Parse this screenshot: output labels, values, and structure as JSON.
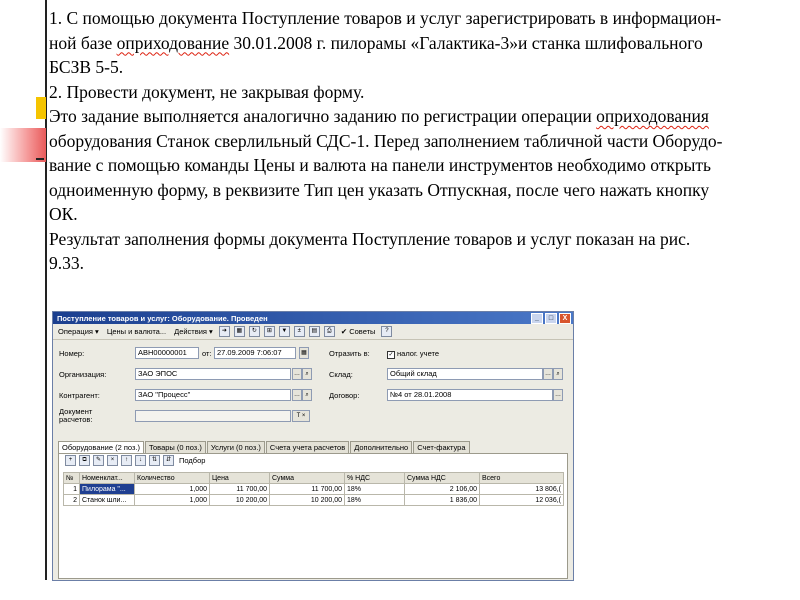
{
  "slide": {
    "lines": [
      {
        "segments": [
          "1. С помощью документа Поступление товаров и услуг зарегистрировать в информацион-"
        ]
      },
      {
        "segments": [
          "ной базе ",
          {
            "w": "оприходование"
          },
          " 30.01.2008 г. пилорамы «Галактика-3»и станка шлифовального"
        ]
      },
      {
        "segments": [
          "БСЗВ 5-5."
        ]
      },
      {
        "segments": [
          "2. Провести документ, не закрывая форму."
        ]
      },
      {
        "segments": [
          "Это задание выполняется аналогично заданию по регистрации операции ",
          {
            "w": "оприходования"
          }
        ]
      },
      {
        "segments": [
          "оборудования Станок сверлильный СДС-1. Перед заполнением табличной части Оборудо-"
        ]
      },
      {
        "segments": [
          "вание с помощью команды Цены и валюта на панели инструментов необходимо открыть"
        ]
      },
      {
        "segments": [
          "одноименную форму, в реквизите Тип цен указать Отпускная, после чего нажать кнопку"
        ]
      },
      {
        "segments": [
          "ОК."
        ]
      },
      {
        "segments": [
          "Результат заполнения формы документа Поступление товаров и услуг показан на рис."
        ]
      },
      {
        "segments": [
          "9.33."
        ]
      }
    ]
  },
  "window": {
    "title": "Поступление товаров и услуг: Оборудование. Проведен",
    "title_buttons": [
      "_",
      "□",
      "X"
    ],
    "toolbar": {
      "operation": "Операция ▾",
      "prices": "Цены и валюта...",
      "actions": "Действия ▾",
      "advice": "Советы",
      "help": "?"
    },
    "form": {
      "number_label": "Номер:",
      "number_value": "АВН00000001",
      "from_label": "от:",
      "date_value": "27.09.2009 7:06:07",
      "reflect_label": "Отразить в:",
      "tax_label": "налог. учете",
      "org_label": "Организация:",
      "org_value": "ЗАО ЭПОС",
      "warehouse_label": "Склад:",
      "warehouse_value": "Общий склад",
      "counterparty_label": "Контрагент:",
      "counterparty_value": "ЗАО \"Процесс\"",
      "contract_label": "Договор:",
      "contract_value": "№4 от 28.01.2008",
      "settle_label1": "Документ",
      "settle_label2": "расчетов:",
      "settle_btn": "T ×"
    },
    "tabs": [
      "Оборудование (2 поз.)",
      "Товары (0 поз.)",
      "Услуги (0 поз.)",
      "Счета учета расчетов",
      "Дополнительно",
      "Счет-фактура"
    ],
    "panel_tool": "Подбор",
    "grid": {
      "headers": [
        "№",
        "Номенклат...",
        "Количество",
        "Цена",
        "Сумма",
        "% НДС",
        "Сумма НДС",
        "Всего"
      ],
      "rows": [
        [
          "1",
          "Пилорама \"...",
          "1,000",
          "11 700,00",
          "11 700,00",
          "18%",
          "2 106,00",
          "13 806,("
        ],
        [
          "2",
          "Станок шли...",
          "1,000",
          "10 200,00",
          "10 200,00",
          "18%",
          "1 836,00",
          "12 036,("
        ]
      ]
    }
  }
}
